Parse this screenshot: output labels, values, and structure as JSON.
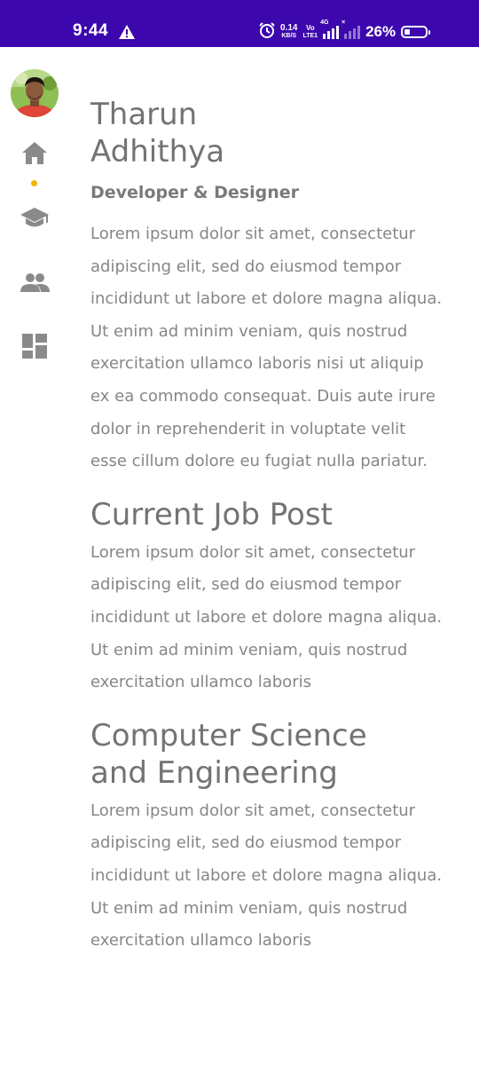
{
  "status_bar": {
    "time": "9:44",
    "net_speed_value": "0.14",
    "net_speed_unit": "KB/S",
    "volte_top": "Vo",
    "volte_bottom": "LTE1",
    "sim1_tag": "4G",
    "sim2_tag": "×",
    "battery_percent": "26%",
    "battery_level": 0.26,
    "background_color": "#3c08ad"
  },
  "nav": {
    "items": [
      {
        "icon": "home-icon",
        "active": true
      },
      {
        "icon": "graduation-cap-icon",
        "active": false
      },
      {
        "icon": "people-icon",
        "active": false
      },
      {
        "icon": "dashboard-icon",
        "active": false
      }
    ],
    "active_indicator_color": "#f4b400",
    "icon_color": "#8a8a8a"
  },
  "profile": {
    "first_name": "Tharun",
    "last_name": "Adhithya",
    "role": "Developer & Designer",
    "bio": "Lorem ipsum dolor sit amet, consectetur adipiscing elit, sed do eiusmod tempor incididunt ut labore et dolore magna aliqua. Ut enim ad minim veniam, quis nostrud exercitation ullamco laboris nisi ut aliquip ex ea commodo consequat. Duis aute irure dolor in reprehenderit in voluptate velit esse cillum dolore eu fugiat nulla pariatur."
  },
  "sections": [
    {
      "title": "Current Job Post",
      "body": "Lorem ipsum dolor sit amet, consectetur adipiscing elit, sed do eiusmod tempor incididunt ut labore et dolore magna aliqua. Ut enim ad minim veniam, quis nostrud exercitation ullamco laboris"
    },
    {
      "title": "Computer Science and Engineering",
      "body": "Lorem ipsum dolor sit amet, consectetur adipiscing elit, sed do eiusmod tempor incididunt ut labore et dolore magna aliqua. Ut enim ad minim veniam, quis nostrud exercitation ullamco laboris"
    }
  ]
}
